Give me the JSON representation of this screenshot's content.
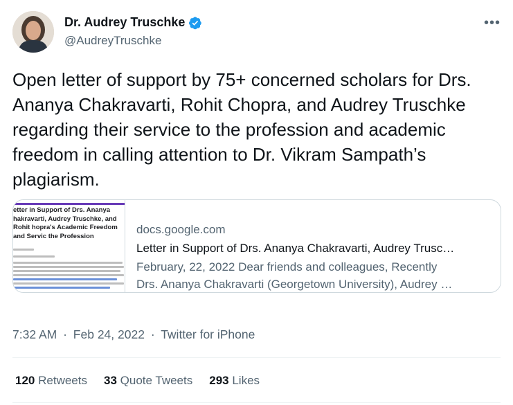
{
  "author": {
    "name": "Dr. Audrey Truschke",
    "handle": "@AudreyTruschke",
    "verified": true
  },
  "tweet": {
    "text": "Open letter of support by 75+ concerned scholars for Drs. Ananya Chakravarti, Rohit Chopra, and Audrey Truschke regarding their service to the profession and academic freedom in calling attention to Dr. Vikram Sampath’s plagiarism."
  },
  "card": {
    "thumbnail_title": "etter in Support of Drs. Ananya hakravarti, Audrey Truschke, and Rohit hopra's Academic Freedom and Servic the Profession",
    "domain": "docs.google.com",
    "title": "Letter in Support of Drs. Ananya Chakravarti, Audrey Trusc…",
    "description_line1": "February, 22, 2022 Dear friends and colleagues, Recently",
    "description_line2": "Drs. Ananya Chakravarti (Georgetown University), Audrey …"
  },
  "meta": {
    "time": "7:32 AM",
    "separator": "·",
    "date": "Feb 24, 2022",
    "source": "Twitter for iPhone"
  },
  "stats": {
    "retweets_count": "120",
    "retweets_label": "Retweets",
    "quotes_count": "33",
    "quotes_label": "Quote Tweets",
    "likes_count": "293",
    "likes_label": "Likes"
  },
  "colors": {
    "verified_blue": "#1d9bf0",
    "secondary_text": "#536471",
    "primary_text": "#0f1419",
    "border": "#cfd9de"
  }
}
